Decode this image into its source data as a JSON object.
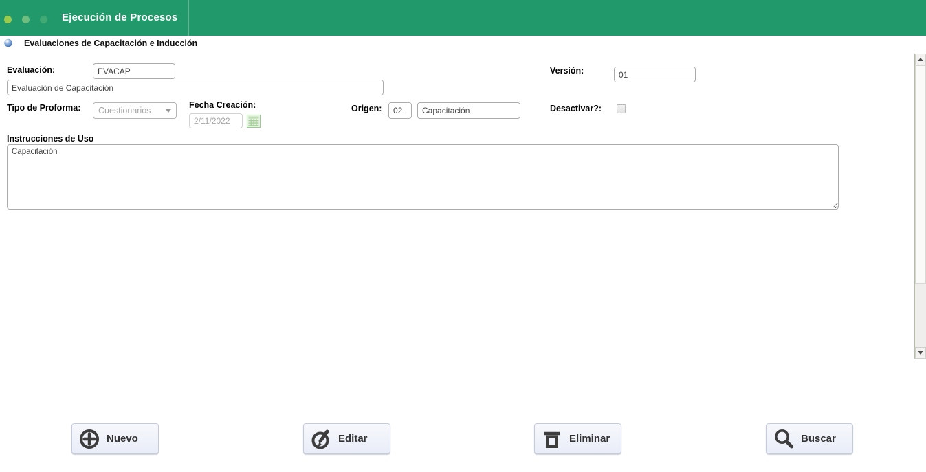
{
  "header": {
    "title": "Ejecución de Procesos"
  },
  "page": {
    "title": "Evaluaciones de Capacitación e Inducción"
  },
  "form": {
    "evaluacion": {
      "label": "Evaluación:",
      "code": "EVACAP",
      "description": "Evaluación de Capacitación"
    },
    "version": {
      "label": "Versión:",
      "value": "01"
    },
    "tipo_proforma": {
      "label": "Tipo de Proforma:",
      "value": "Cuestionarios",
      "disabled": true
    },
    "fecha_creacion": {
      "label": "Fecha Creación:",
      "value": "2/11/2022",
      "disabled": true
    },
    "origen": {
      "label": "Origen:",
      "code": "02",
      "description": "Capacitación"
    },
    "desactivar": {
      "label": "Desactivar?:",
      "checked": false
    },
    "instrucciones": {
      "label": "Instrucciones de Uso",
      "value": "Capacitación"
    }
  },
  "buttons": [
    {
      "id": "nuevo",
      "label": "Nuevo",
      "icon": "plus-circle-icon"
    },
    {
      "id": "editar",
      "label": "Editar",
      "icon": "pencil-circle-icon"
    },
    {
      "id": "eliminar",
      "label": "Eliminar",
      "icon": "trash-icon"
    },
    {
      "id": "buscar",
      "label": "Buscar",
      "icon": "magnifier-icon"
    }
  ],
  "colors": {
    "header_green": "#21996a",
    "dot_bright": "#9bcb4d",
    "button_icon": "#3d3d3d",
    "calendar_green": "#94ca8b"
  }
}
